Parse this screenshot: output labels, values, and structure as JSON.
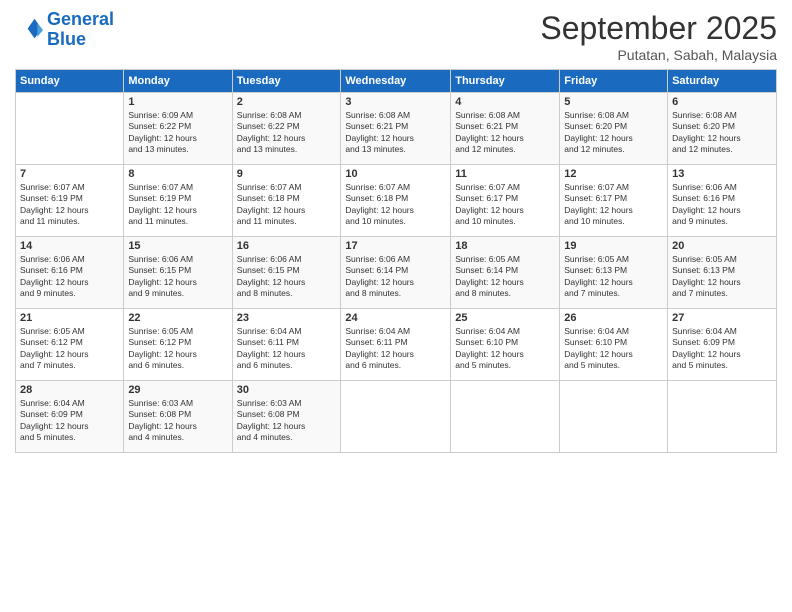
{
  "logo": {
    "line1": "General",
    "line2": "Blue"
  },
  "title": "September 2025",
  "subtitle": "Putatan, Sabah, Malaysia",
  "days_header": [
    "Sunday",
    "Monday",
    "Tuesday",
    "Wednesday",
    "Thursday",
    "Friday",
    "Saturday"
  ],
  "weeks": [
    [
      {
        "num": "",
        "info": ""
      },
      {
        "num": "1",
        "info": "Sunrise: 6:09 AM\nSunset: 6:22 PM\nDaylight: 12 hours\nand 13 minutes."
      },
      {
        "num": "2",
        "info": "Sunrise: 6:08 AM\nSunset: 6:22 PM\nDaylight: 12 hours\nand 13 minutes."
      },
      {
        "num": "3",
        "info": "Sunrise: 6:08 AM\nSunset: 6:21 PM\nDaylight: 12 hours\nand 13 minutes."
      },
      {
        "num": "4",
        "info": "Sunrise: 6:08 AM\nSunset: 6:21 PM\nDaylight: 12 hours\nand 12 minutes."
      },
      {
        "num": "5",
        "info": "Sunrise: 6:08 AM\nSunset: 6:20 PM\nDaylight: 12 hours\nand 12 minutes."
      },
      {
        "num": "6",
        "info": "Sunrise: 6:08 AM\nSunset: 6:20 PM\nDaylight: 12 hours\nand 12 minutes."
      }
    ],
    [
      {
        "num": "7",
        "info": "Sunrise: 6:07 AM\nSunset: 6:19 PM\nDaylight: 12 hours\nand 11 minutes."
      },
      {
        "num": "8",
        "info": "Sunrise: 6:07 AM\nSunset: 6:19 PM\nDaylight: 12 hours\nand 11 minutes."
      },
      {
        "num": "9",
        "info": "Sunrise: 6:07 AM\nSunset: 6:18 PM\nDaylight: 12 hours\nand 11 minutes."
      },
      {
        "num": "10",
        "info": "Sunrise: 6:07 AM\nSunset: 6:18 PM\nDaylight: 12 hours\nand 10 minutes."
      },
      {
        "num": "11",
        "info": "Sunrise: 6:07 AM\nSunset: 6:17 PM\nDaylight: 12 hours\nand 10 minutes."
      },
      {
        "num": "12",
        "info": "Sunrise: 6:07 AM\nSunset: 6:17 PM\nDaylight: 12 hours\nand 10 minutes."
      },
      {
        "num": "13",
        "info": "Sunrise: 6:06 AM\nSunset: 6:16 PM\nDaylight: 12 hours\nand 9 minutes."
      }
    ],
    [
      {
        "num": "14",
        "info": "Sunrise: 6:06 AM\nSunset: 6:16 PM\nDaylight: 12 hours\nand 9 minutes."
      },
      {
        "num": "15",
        "info": "Sunrise: 6:06 AM\nSunset: 6:15 PM\nDaylight: 12 hours\nand 9 minutes."
      },
      {
        "num": "16",
        "info": "Sunrise: 6:06 AM\nSunset: 6:15 PM\nDaylight: 12 hours\nand 8 minutes."
      },
      {
        "num": "17",
        "info": "Sunrise: 6:06 AM\nSunset: 6:14 PM\nDaylight: 12 hours\nand 8 minutes."
      },
      {
        "num": "18",
        "info": "Sunrise: 6:05 AM\nSunset: 6:14 PM\nDaylight: 12 hours\nand 8 minutes."
      },
      {
        "num": "19",
        "info": "Sunrise: 6:05 AM\nSunset: 6:13 PM\nDaylight: 12 hours\nand 7 minutes."
      },
      {
        "num": "20",
        "info": "Sunrise: 6:05 AM\nSunset: 6:13 PM\nDaylight: 12 hours\nand 7 minutes."
      }
    ],
    [
      {
        "num": "21",
        "info": "Sunrise: 6:05 AM\nSunset: 6:12 PM\nDaylight: 12 hours\nand 7 minutes."
      },
      {
        "num": "22",
        "info": "Sunrise: 6:05 AM\nSunset: 6:12 PM\nDaylight: 12 hours\nand 6 minutes."
      },
      {
        "num": "23",
        "info": "Sunrise: 6:04 AM\nSunset: 6:11 PM\nDaylight: 12 hours\nand 6 minutes."
      },
      {
        "num": "24",
        "info": "Sunrise: 6:04 AM\nSunset: 6:11 PM\nDaylight: 12 hours\nand 6 minutes."
      },
      {
        "num": "25",
        "info": "Sunrise: 6:04 AM\nSunset: 6:10 PM\nDaylight: 12 hours\nand 5 minutes."
      },
      {
        "num": "26",
        "info": "Sunrise: 6:04 AM\nSunset: 6:10 PM\nDaylight: 12 hours\nand 5 minutes."
      },
      {
        "num": "27",
        "info": "Sunrise: 6:04 AM\nSunset: 6:09 PM\nDaylight: 12 hours\nand 5 minutes."
      }
    ],
    [
      {
        "num": "28",
        "info": "Sunrise: 6:04 AM\nSunset: 6:09 PM\nDaylight: 12 hours\nand 5 minutes."
      },
      {
        "num": "29",
        "info": "Sunrise: 6:03 AM\nSunset: 6:08 PM\nDaylight: 12 hours\nand 4 minutes."
      },
      {
        "num": "30",
        "info": "Sunrise: 6:03 AM\nSunset: 6:08 PM\nDaylight: 12 hours\nand 4 minutes."
      },
      {
        "num": "",
        "info": ""
      },
      {
        "num": "",
        "info": ""
      },
      {
        "num": "",
        "info": ""
      },
      {
        "num": "",
        "info": ""
      }
    ]
  ]
}
